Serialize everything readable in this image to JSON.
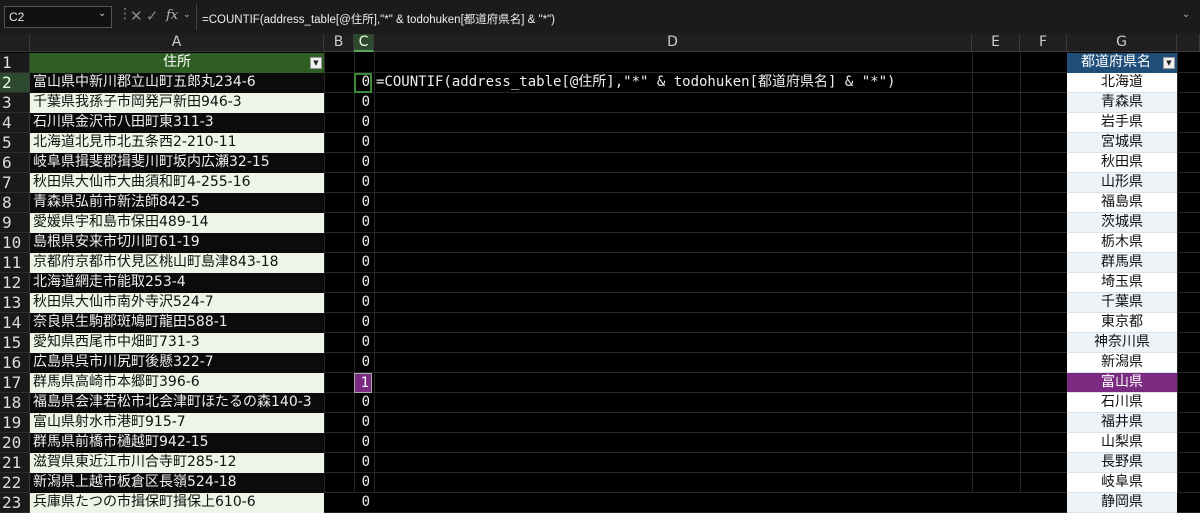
{
  "formula_bar": {
    "name_box": "C2",
    "formula": "=COUNTIF(address_table[@住所],\"*\" & todohuken[都道府県名] & \"*\")"
  },
  "columns": [
    "A",
    "B",
    "C",
    "D",
    "E",
    "F",
    "G"
  ],
  "rows": [
    "1",
    "2",
    "3",
    "4",
    "5",
    "6",
    "7",
    "8",
    "9",
    "10",
    "11",
    "12",
    "13",
    "14",
    "15",
    "16",
    "17",
    "18",
    "19",
    "20",
    "21",
    "22",
    "23"
  ],
  "address_table": {
    "header": "住所",
    "addresses": [
      "富山県中新川郡立山町五郎丸234-6",
      "千葉県我孫子市岡発戸新田946-3",
      "石川県金沢市八田町東311-3",
      "北海道北見市北五条西2-210-11",
      "岐阜県揖斐郡揖斐川町坂内広瀬32-15",
      "秋田県大仙市大曲須和町4-255-16",
      "青森県弘前市新法師842-5",
      "愛媛県宇和島市保田489-14",
      "島根県安来市切川町61-19",
      "京都府京都市伏見区桃山町島津843-18",
      "北海道網走市能取253-4",
      "秋田県大仙市南外寺沢524-7",
      "奈良県生駒郡斑鳩町龍田588-1",
      "愛知県西尾市中畑町731-3",
      "広島県呉市川尻町後懸322-7",
      "群馬県高崎市本郷町396-6",
      "福島県会津若松市北会津町ほたるの森140-3",
      "富山県射水市港町915-7",
      "群馬県前橋市樋越町942-15",
      "滋賀県東近江市川合寺町285-12",
      "新潟県上越市板倉区長嶺524-18",
      "兵庫県たつの市揖保町揖保上610-6"
    ]
  },
  "column_c": {
    "values": [
      "0",
      "0",
      "0",
      "0",
      "0",
      "0",
      "0",
      "0",
      "0",
      "0",
      "0",
      "0",
      "0",
      "0",
      "0",
      "1",
      "0",
      "0",
      "0",
      "0",
      "0",
      "0"
    ]
  },
  "spill_text": "=COUNTIF(address_table[@住所],\"*\" & todohuken[都道府県名] & \"*\")",
  "todohuken": {
    "header": "都道府県名",
    "prefectures": [
      "北海道",
      "青森県",
      "岩手県",
      "宮城県",
      "秋田県",
      "山形県",
      "福島県",
      "茨城県",
      "栃木県",
      "群馬県",
      "埼玉県",
      "千葉県",
      "東京都",
      "神奈川県",
      "新潟県",
      "富山県",
      "石川県",
      "福井県",
      "山梨県",
      "長野県",
      "岐阜県",
      "静岡県"
    ]
  },
  "colors": {
    "highlight": "#7b2a82",
    "table_header_a": "#2f5e23",
    "table_header_g": "#1f4e78",
    "selected_header": "#2e4a2e"
  },
  "icons": {
    "cancel": "x-icon",
    "confirm": "check-icon",
    "function": "fx-icon"
  }
}
